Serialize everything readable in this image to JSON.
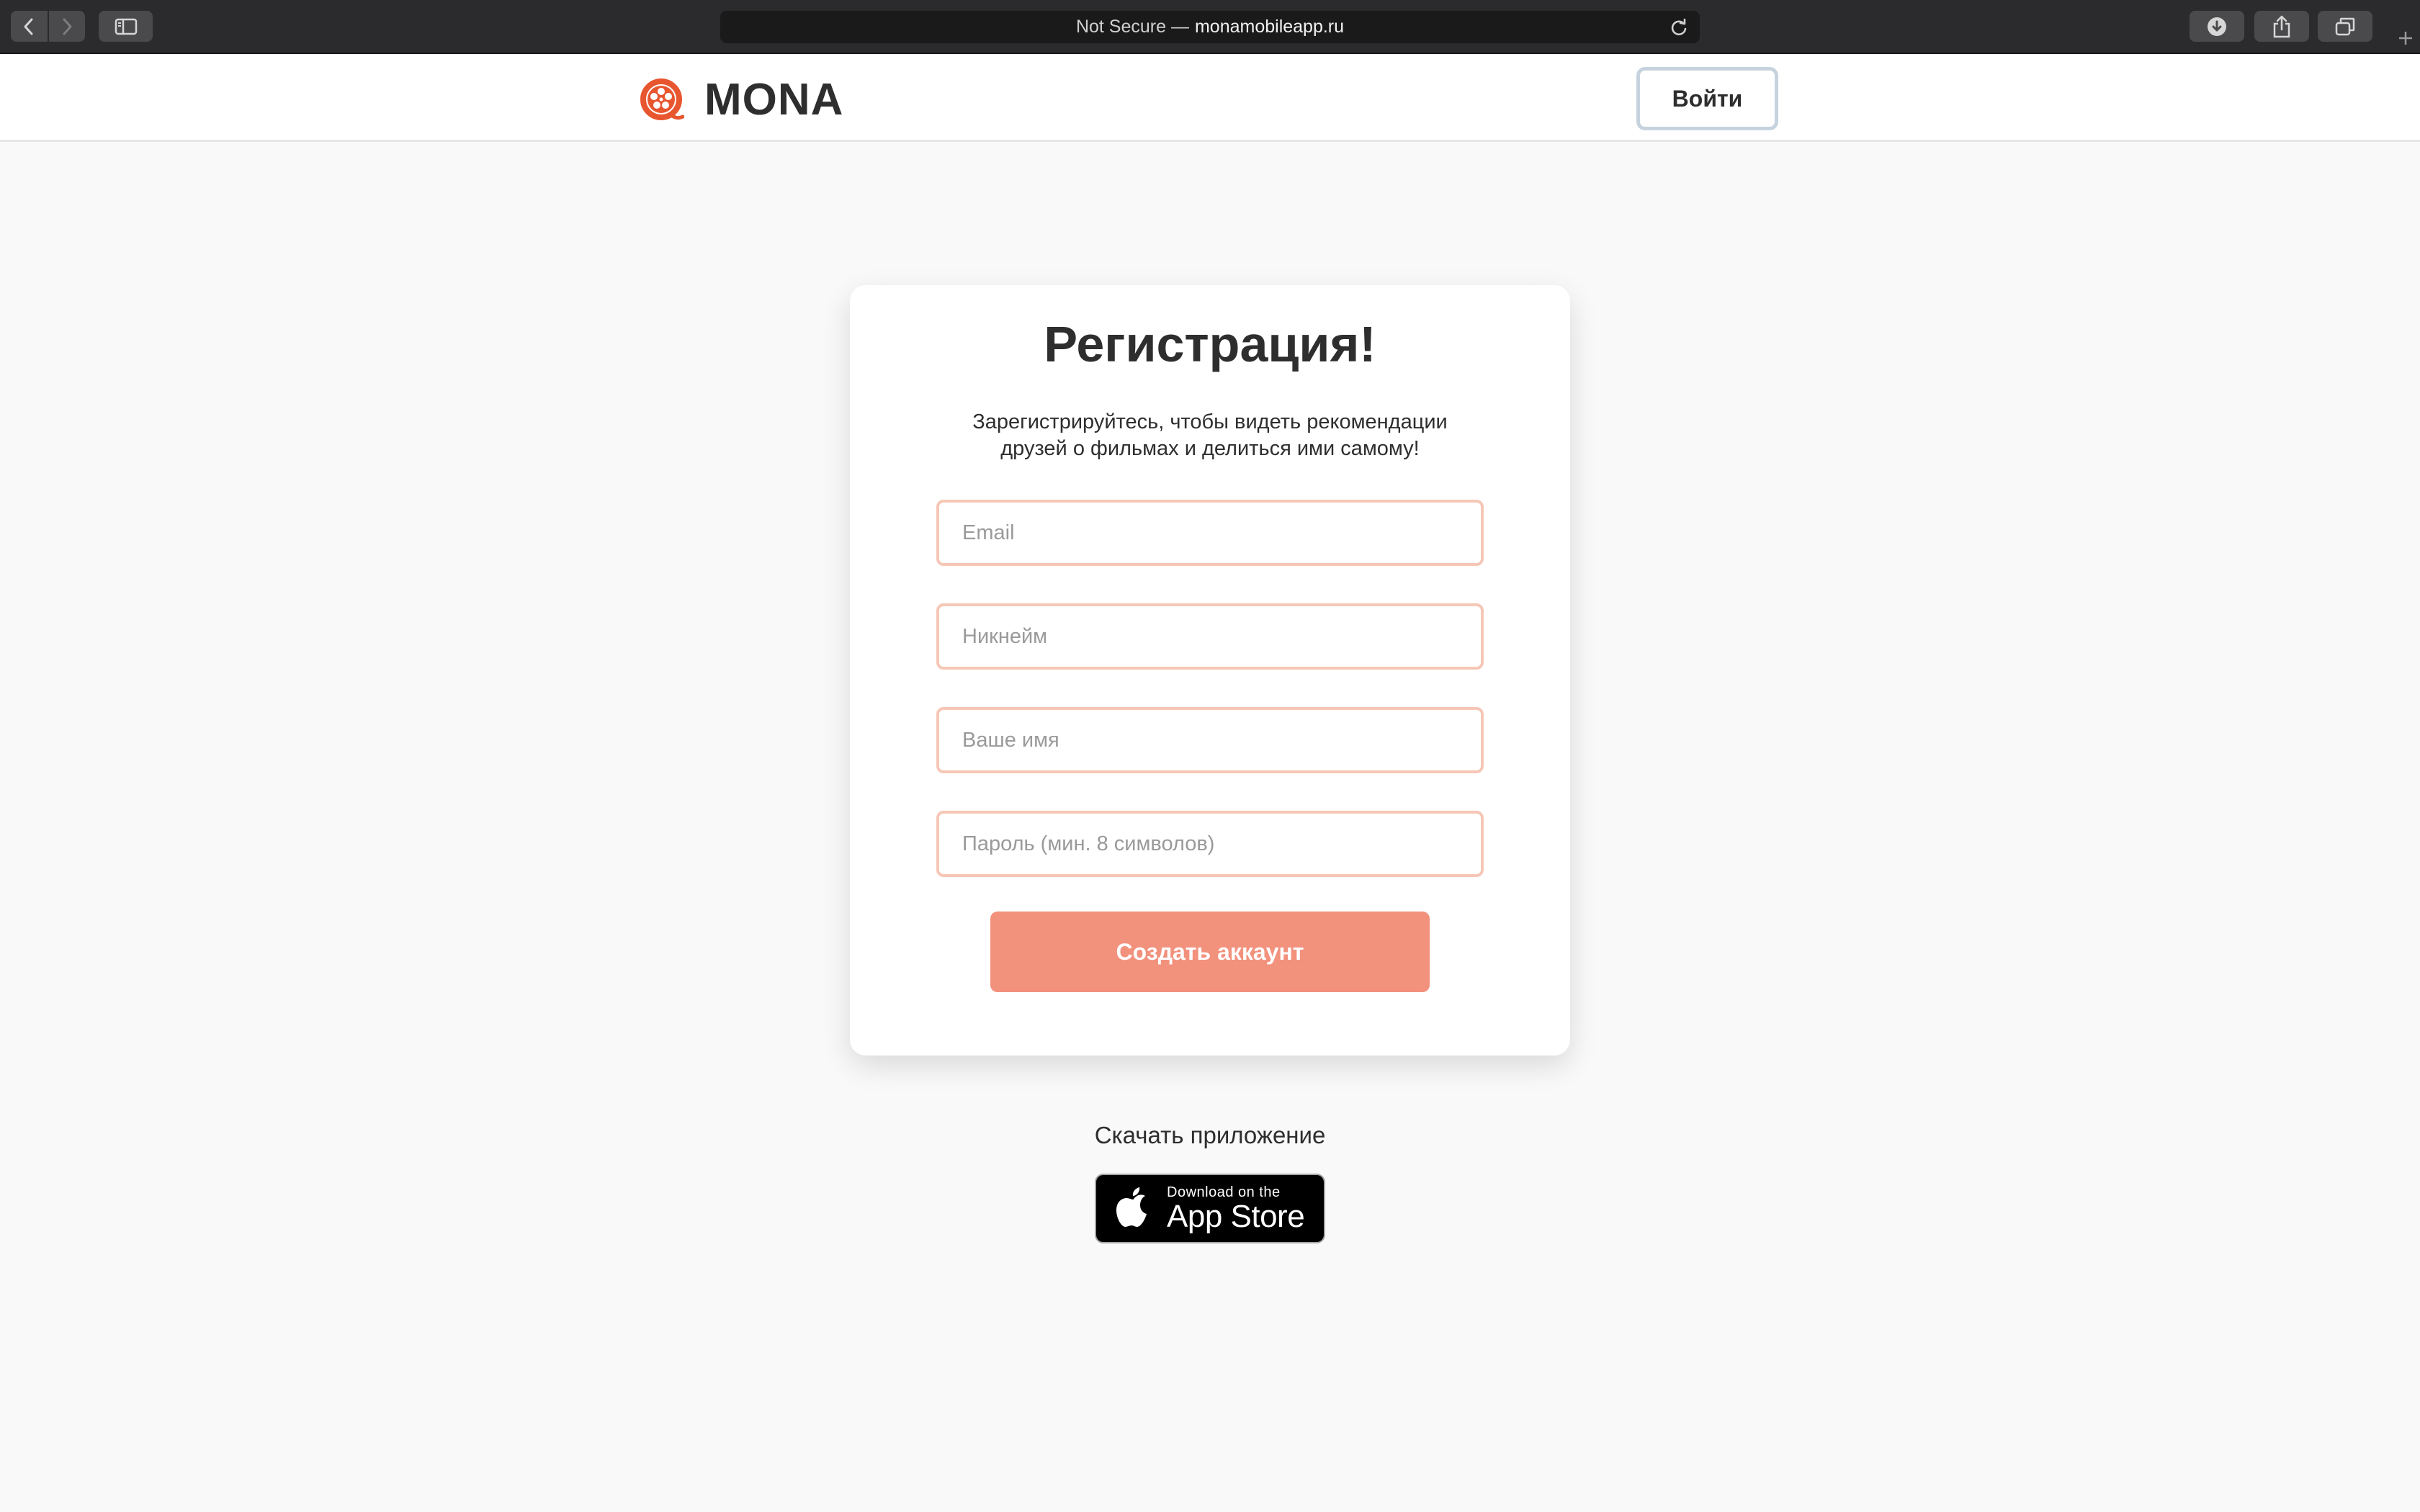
{
  "browser": {
    "security_label": "Not Secure —",
    "host": "monamobileapp.ru"
  },
  "header": {
    "logo_text": "MONA",
    "login_label": "Войти"
  },
  "card": {
    "title": "Регистрация!",
    "subtitle_line1": "Зарегистрируйтесь, чтобы видеть рекомендации",
    "subtitle_line2": "друзей о фильмах и делиться ими самому!",
    "email_placeholder": "Email",
    "nickname_placeholder": "Никнейм",
    "name_placeholder": "Ваше имя",
    "password_placeholder": "Пароль (мин. 8 символов)",
    "submit_label": "Создать аккаунт"
  },
  "download": {
    "label": "Скачать приложение",
    "badge_small": "Download on the",
    "badge_big": "App Store"
  },
  "colors": {
    "accent": "#f2917c",
    "field_border": "#f6c7b6",
    "logo": "#e8562f",
    "login_border": "#c6d3df"
  },
  "icons": [
    "back-icon",
    "forward-icon",
    "sidebar-icon",
    "reload-icon",
    "download-icon",
    "share-icon",
    "tabs-icon",
    "new-tab-icon",
    "mona-logo-icon",
    "apple-icon"
  ]
}
